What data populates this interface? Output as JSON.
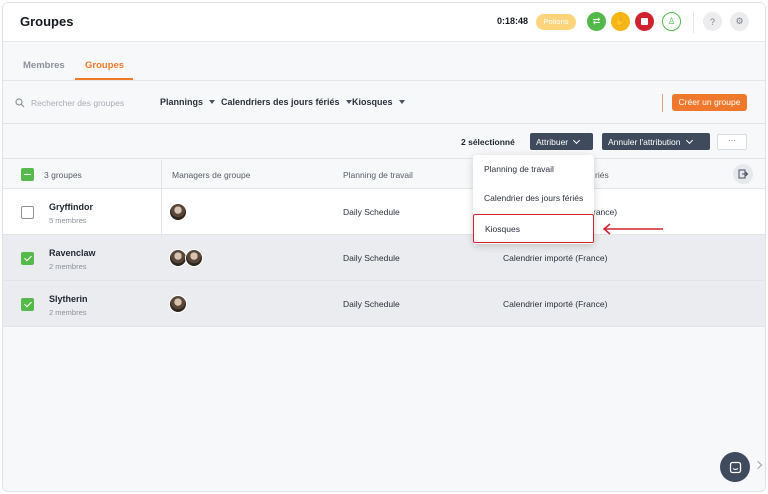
{
  "header": {
    "title": "Groupes",
    "timer": "0:18:48",
    "badge": "Potions"
  },
  "tabs": [
    {
      "label": "Membres",
      "active": false
    },
    {
      "label": "Groupes",
      "active": true
    }
  ],
  "filters": {
    "search_placeholder": "Rechercher des groupes",
    "plannings": "Plannings",
    "calendriers": "Calendriers des jours fériés",
    "kiosques": "Kiosques",
    "create_button": "Créer un groupe"
  },
  "actions": {
    "selected_count": "2 sélectionné",
    "assign": "Attribuer",
    "unassign": "Annuler l'attribution",
    "more": "···"
  },
  "table": {
    "select_all_label": "3 groupes",
    "columns": {
      "managers": "Managers de groupe",
      "planning": "Planning de travail",
      "calendar_suffix": "riés"
    },
    "rows": [
      {
        "name": "Gryffindor",
        "count": "5 membres",
        "planning": "Daily Schedule",
        "calendar": "rance)",
        "selected": false
      },
      {
        "name": "Ravenclaw",
        "count": "2 membres",
        "planning": "Daily Schedule",
        "calendar": "Calendrier importé (France)",
        "selected": true
      },
      {
        "name": "Slytherin",
        "count": "2 membres",
        "planning": "Daily Schedule",
        "calendar": "Calendrier importé (France)",
        "selected": true
      }
    ]
  },
  "dropdown": {
    "items": [
      "Planning de travail",
      "Calendrier des jours fériés",
      "Kiosques"
    ],
    "highlighted_index": 2
  },
  "colors": {
    "accent": "#f0782d",
    "check": "#56b94b",
    "dark_button": "#3f4a5d",
    "highlight": "#d0212f"
  }
}
